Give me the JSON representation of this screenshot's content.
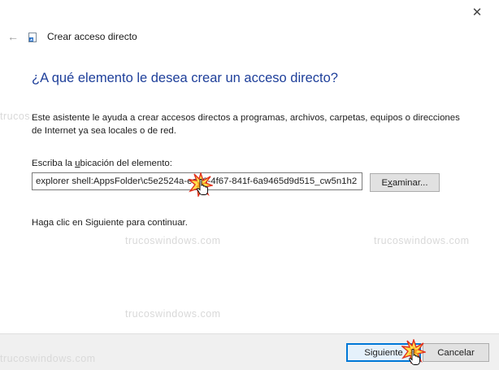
{
  "window": {
    "title": "Crear acceso directo",
    "close_glyph": "✕",
    "back_glyph": "←"
  },
  "main": {
    "heading": "¿A qué elemento le desea crear un acceso directo?",
    "description": "Este asistente le ayuda a crear accesos directos a programas, archivos, carpetas, equipos o direcciones de Internet ya sea locales o de red.",
    "location_label_before": "Escriba la ",
    "location_label_accel": "u",
    "location_label_after": "bicación del elemento:",
    "location_value": "explorer shell:AppsFolder\\c5e2524a-ea46-4f67-841f-6a9465d9d515_cw5n1h2",
    "browse_accel": "x",
    "browse_before": "E",
    "browse_after": "aminar...",
    "continue_text": "Haga clic en Siguiente para continuar."
  },
  "footer": {
    "next_label": "Siguiente",
    "cancel_label": "Cancelar"
  },
  "watermarks": {
    "w1": "trucoswindows.com",
    "w2": "trucoswindows.com",
    "w3": "trucoswindows.com",
    "w4": "trucoswindows.com",
    "w5": "trucos"
  },
  "colors": {
    "heading": "#1e3f9a",
    "accent": "#0078d7",
    "footer_bg": "#f0f0f0",
    "button_bg": "#e1e1e1",
    "watermark": "#d9d9d9"
  },
  "icons": {
    "back": "back-arrow-icon",
    "close": "close-icon",
    "wizard": "shortcut-icon",
    "cursor": "hand-cursor-icon",
    "click": "click-burst-icon"
  }
}
